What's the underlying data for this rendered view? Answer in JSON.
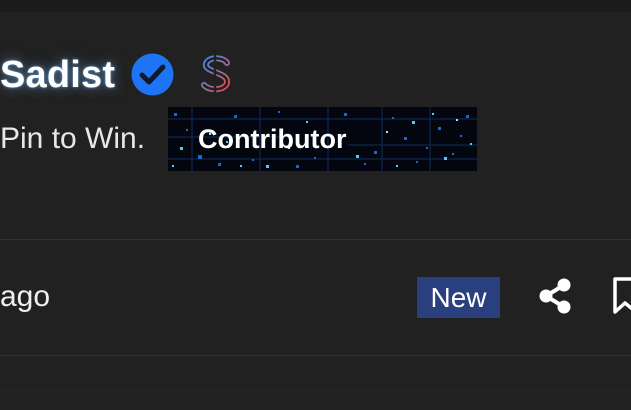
{
  "profile": {
    "username": "Sadist",
    "tagline": "Pin to Win.",
    "badge_label": "Contributor"
  },
  "post_meta": {
    "time_text": "ago",
    "status_badge": "New"
  },
  "icons": {
    "verified": "verified-check-icon",
    "supporter": "dollar-icon",
    "share": "share-icon",
    "bookmark": "bookmark-icon"
  },
  "colors": {
    "background": "#212121",
    "verified_blue": "#1d74f5",
    "new_badge": "#2a3f7e",
    "contributor_glow": "#2a8cff"
  }
}
